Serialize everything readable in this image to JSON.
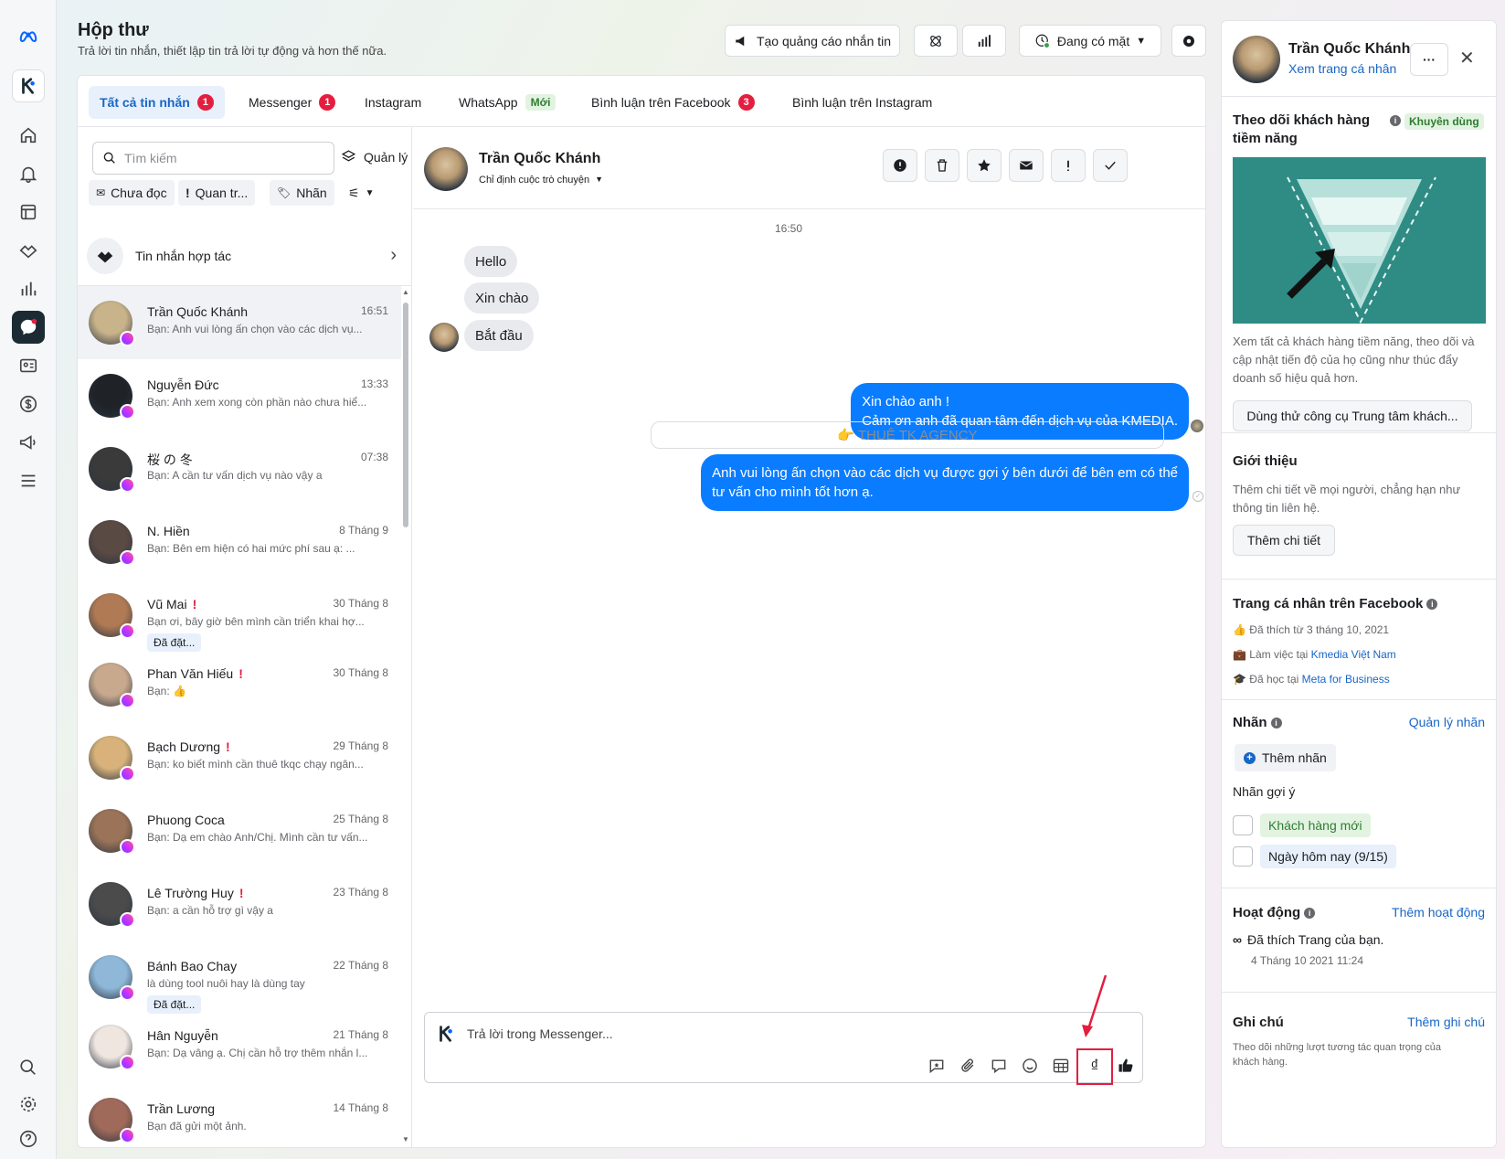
{
  "header": {
    "title": "Hộp thư",
    "subtitle": "Trả lời tin nhắn, thiết lập tin trả lời tự động và hơn thế nữa.",
    "create_ad_label": "Tạo quảng cáo nhắn tin",
    "presence_label": "Đang có mặt"
  },
  "tabs": [
    {
      "label": "Tất cả tin nhắn",
      "badge": "1"
    },
    {
      "label": "Messenger",
      "badge": "1"
    },
    {
      "label": "Instagram"
    },
    {
      "label": "WhatsApp",
      "badge": "Mới"
    },
    {
      "label": "Bình luận trên Facebook",
      "badge": "3"
    },
    {
      "label": "Bình luận trên Instagram"
    }
  ],
  "list": {
    "search_placeholder": "Tìm kiếm",
    "manage_label": "Quản lý",
    "filters": [
      "Chưa đọc",
      "Quan tr...",
      "Nhãn"
    ],
    "collab_label": "Tin nhắn hợp tác",
    "conversations": [
      {
        "name": "Trần Quốc Khánh",
        "time": "16:51",
        "preview": "Bạn: Anh vui lòng ấn chọn vào các dịch vụ...",
        "important": false,
        "tag": "",
        "color": "#c9b38a"
      },
      {
        "name": "Nguyễn Đức",
        "time": "13:33",
        "preview": "Bạn: Anh xem xong còn phần nào chưa hiể...",
        "important": false,
        "tag": "",
        "color": "#1f2328"
      },
      {
        "name": "桜 の 冬",
        "time": "07:38",
        "preview": "Bạn: A cần tư vấn dịch vụ nào vậy a",
        "important": false,
        "tag": "",
        "color": "#3a3a3a"
      },
      {
        "name": "N. Hiền",
        "time": "8 Tháng 9",
        "preview": "Bạn: Bên em hiện có hai mức phí sau ạ: ...",
        "important": false,
        "tag": "",
        "color": "#5a4a44"
      },
      {
        "name": "Vũ Mai",
        "time": "30 Tháng 8",
        "preview": "Bạn ơi, bây giờ bên mình cần triển khai hợ...",
        "important": true,
        "tag": "Đã đặt...",
        "color": "#b07a55"
      },
      {
        "name": "Phan Văn Hiếu",
        "time": "30 Tháng 8",
        "preview": "Bạn: 👍",
        "important": true,
        "tag": "",
        "color": "#c8a98e"
      },
      {
        "name": "Bạch Dương",
        "time": "29 Tháng 8",
        "preview": "Bạn: ko biết mình cần thuê tkqc chạy ngân...",
        "important": true,
        "tag": "",
        "color": "#d8b27a"
      },
      {
        "name": "Phuong Coca",
        "time": "25 Tháng 8",
        "preview": "Bạn: Dạ em chào Anh/Chị. Mình cần tư vấn...",
        "important": false,
        "tag": "",
        "color": "#9a7358"
      },
      {
        "name": "Lê Trường Huy",
        "time": "23 Tháng 8",
        "preview": "Bạn: a cần hỗ trợ gì vậy a",
        "important": true,
        "tag": "",
        "color": "#4b4b4b"
      },
      {
        "name": "Bánh Bao Chay",
        "time": "22 Tháng 8",
        "preview": "là dùng tool nuôi hay là dùng tay",
        "important": false,
        "tag": "Đã đặt...",
        "color": "#8fb8d8"
      },
      {
        "name": "Hân Nguyễn",
        "time": "21 Tháng 8",
        "preview": "Bạn: Dạ vâng ạ. Chị cần hỗ trợ thêm nhắn l...",
        "important": false,
        "tag": "",
        "color": "#efe6e0"
      },
      {
        "name": "Trần Lương",
        "time": "14 Tháng 8",
        "preview": "Bạn đã gửi một ảnh.",
        "important": false,
        "tag": "",
        "color": "#a06a5a"
      }
    ]
  },
  "chat": {
    "name": "Trần Quốc Khánh",
    "assign_label": "Chỉ định cuộc trò chuyện",
    "timestamp": "16:50",
    "incoming": [
      "Hello",
      "Xin chào",
      "Bắt đầu"
    ],
    "outgoing_1": [
      "Xin chào anh !",
      "Cảm ơn anh đã quan tâm đến dịch vụ của KMEDIA."
    ],
    "card_label": "👉 THUÊ TK AGENCY",
    "outgoing_2": [
      "Anh vui lòng ấn chọn vào các dịch vụ được gợi ý bên dưới để bên em có thể",
      "tư vấn cho mình tốt hơn ạ."
    ],
    "composer_placeholder": "Trả lời trong Messenger..."
  },
  "panel": {
    "name": "Trần Quốc Khánh",
    "profile_link": "Xem trang cá nhân",
    "leads_title": "Theo dõi khách hàng tiềm năng",
    "leads_badge": "Khuyên dùng",
    "leads_desc": "Xem tất cả khách hàng tiềm năng, theo dõi và cập nhật tiến độ của họ cũng như thúc đẩy doanh số hiệu quả hơn.",
    "leads_button": "Dùng thử công cụ Trung tâm khách...",
    "intro_title": "Giới thiệu",
    "intro_desc": "Thêm chi tiết về mọi người, chẳng hạn như thông tin liên hệ.",
    "intro_button": "Thêm chi tiết",
    "fb_title": "Trang cá nhân trên Facebook",
    "fb_liked": "Đã thích từ 3 tháng 10, 2021",
    "fb_work_prefix": "Làm việc tại ",
    "fb_work_link": "Kmedia Việt Nam",
    "fb_school_prefix": "Đã học tại ",
    "fb_school_link": "Meta for Business",
    "labels_title": "Nhãn",
    "labels_manage": "Quản lý nhãn",
    "add_label": "Thêm nhãn",
    "suggested_title": "Nhãn gợi ý",
    "suggested": [
      "Khách hàng mới",
      "Ngày hôm nay (9/15)"
    ],
    "activity_title": "Hoạt động",
    "activity_add": "Thêm hoạt động",
    "activity_item": "Đã thích Trang của bạn.",
    "activity_time": "4 Tháng 10 2021 11:24",
    "notes_title": "Ghi chú",
    "notes_add": "Thêm ghi chú",
    "notes_desc": "Theo dõi những lượt tương tác quan trọng của khách hàng."
  },
  "colors": {
    "accent": "#1866c6",
    "outgoing_bubble": "#0a7cff",
    "danger": "#e41e3f",
    "highlight": "#e41e3f"
  }
}
